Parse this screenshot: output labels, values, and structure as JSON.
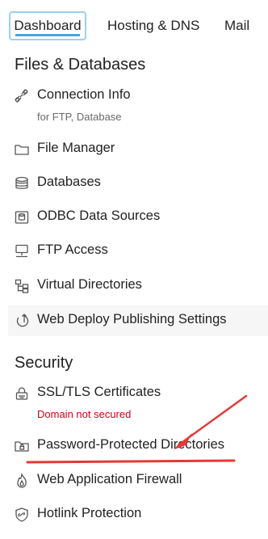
{
  "tabs": [
    {
      "label": "Dashboard",
      "active": true
    },
    {
      "label": "Hosting & DNS",
      "active": false
    },
    {
      "label": "Mail",
      "active": false
    }
  ],
  "sections": {
    "files": {
      "title": "Files & Databases",
      "items": [
        {
          "label": "Connection Info",
          "sub": "for FTP, Database",
          "icon": "connection-icon"
        },
        {
          "label": "File Manager",
          "icon": "folder-icon"
        },
        {
          "label": "Databases",
          "icon": "database-icon"
        },
        {
          "label": "ODBC Data Sources",
          "icon": "odbc-icon"
        },
        {
          "label": "FTP Access",
          "icon": "ftp-icon"
        },
        {
          "label": "Virtual Directories",
          "icon": "virtual-directories-icon"
        },
        {
          "label": "Web Deploy Publishing Settings",
          "icon": "web-deploy-icon"
        }
      ]
    },
    "security": {
      "title": "Security",
      "items": [
        {
          "label": "SSL/TLS Certificates",
          "sub": "Domain not secured",
          "icon": "certificate-lock-icon"
        },
        {
          "label": "Password-Protected Directories",
          "icon": "protected-folder-icon"
        },
        {
          "label": "Web Application Firewall",
          "icon": "firewall-flame-icon"
        },
        {
          "label": "Hotlink Protection",
          "icon": "hotlink-shield-icon"
        }
      ]
    }
  },
  "colors": {
    "accent": "#4fa3db",
    "active_tab_border": "#9cd0ee",
    "danger": "#d0021b",
    "annotation": "#e53935"
  }
}
